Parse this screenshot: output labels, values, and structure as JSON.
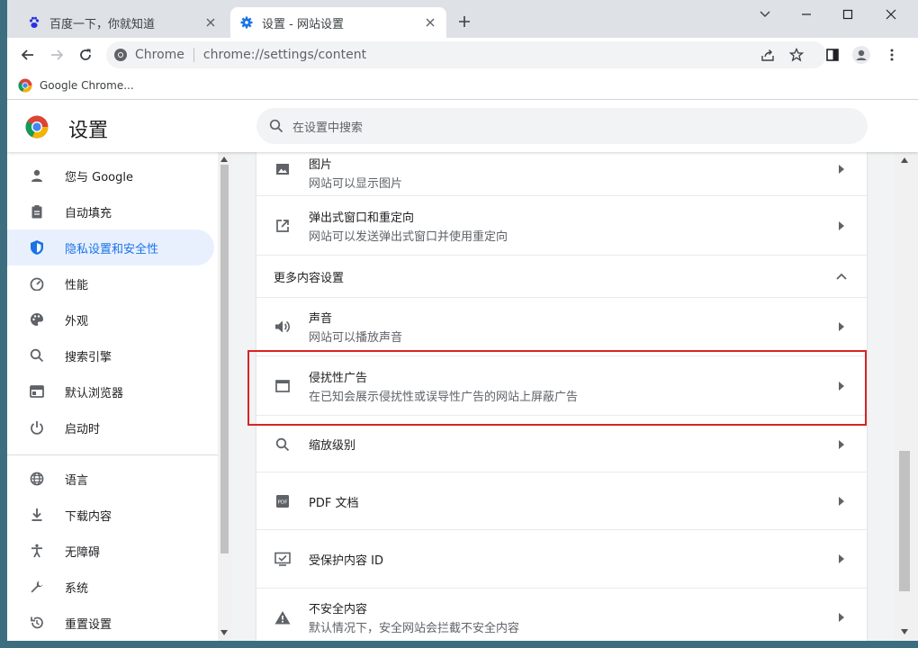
{
  "tabs": [
    {
      "label": "百度一下，你就知道",
      "icon": "baidu-paw-icon",
      "active": false
    },
    {
      "label": "设置 - 网站设置",
      "icon": "settings-gear-icon",
      "active": true
    }
  ],
  "omnibox": {
    "site_label": "Chrome",
    "url": "chrome://settings/content"
  },
  "bookmarks": [
    {
      "label": "Google Chrome..."
    }
  ],
  "settings": {
    "title": "设置",
    "search_placeholder": "在设置中搜索"
  },
  "sidebar": {
    "items": [
      {
        "label": "您与 Google",
        "icon": "person-icon"
      },
      {
        "label": "自动填充",
        "icon": "clipboard-icon"
      },
      {
        "label": "隐私设置和安全性",
        "icon": "shield-icon",
        "selected": true
      },
      {
        "label": "性能",
        "icon": "speedometer-icon"
      },
      {
        "label": "外观",
        "icon": "palette-icon"
      },
      {
        "label": "搜索引擎",
        "icon": "search-icon"
      },
      {
        "label": "默认浏览器",
        "icon": "browser-icon"
      },
      {
        "label": "启动时",
        "icon": "power-icon"
      },
      {
        "label": "语言",
        "icon": "globe-icon"
      },
      {
        "label": "下载内容",
        "icon": "download-icon"
      },
      {
        "label": "无障碍",
        "icon": "accessibility-icon"
      },
      {
        "label": "系统",
        "icon": "wrench-icon"
      },
      {
        "label": "重置设置",
        "icon": "reset-icon"
      }
    ]
  },
  "content": {
    "rows_top": [
      {
        "title": "图片",
        "subtitle": "网站可以显示图片",
        "icon": "image-icon"
      },
      {
        "title": "弹出式窗口和重定向",
        "subtitle": "网站可以发送弹出式窗口并使用重定向",
        "icon": "popup-icon"
      }
    ],
    "section_title": "更多内容设置",
    "rows_more": [
      {
        "title": "声音",
        "subtitle": "网站可以播放声音",
        "icon": "speaker-icon"
      },
      {
        "title": "侵扰性广告",
        "subtitle": "在已知会展示侵扰性或误导性广告的网站上屏蔽广告",
        "icon": "ad-window-icon"
      },
      {
        "title": "缩放级别",
        "subtitle": "",
        "icon": "zoom-icon"
      },
      {
        "title": "PDF 文档",
        "subtitle": "",
        "icon": "pdf-icon"
      },
      {
        "title": "受保护内容 ID",
        "subtitle": "",
        "icon": "protected-content-icon"
      },
      {
        "title": "不安全内容",
        "subtitle": "默认情况下，安全网站会拦截不安全内容",
        "icon": "warning-icon"
      }
    ]
  },
  "colors": {
    "accent": "#1a73e8",
    "highlight": "#d92323",
    "selected_bg": "#e8f0fe"
  }
}
